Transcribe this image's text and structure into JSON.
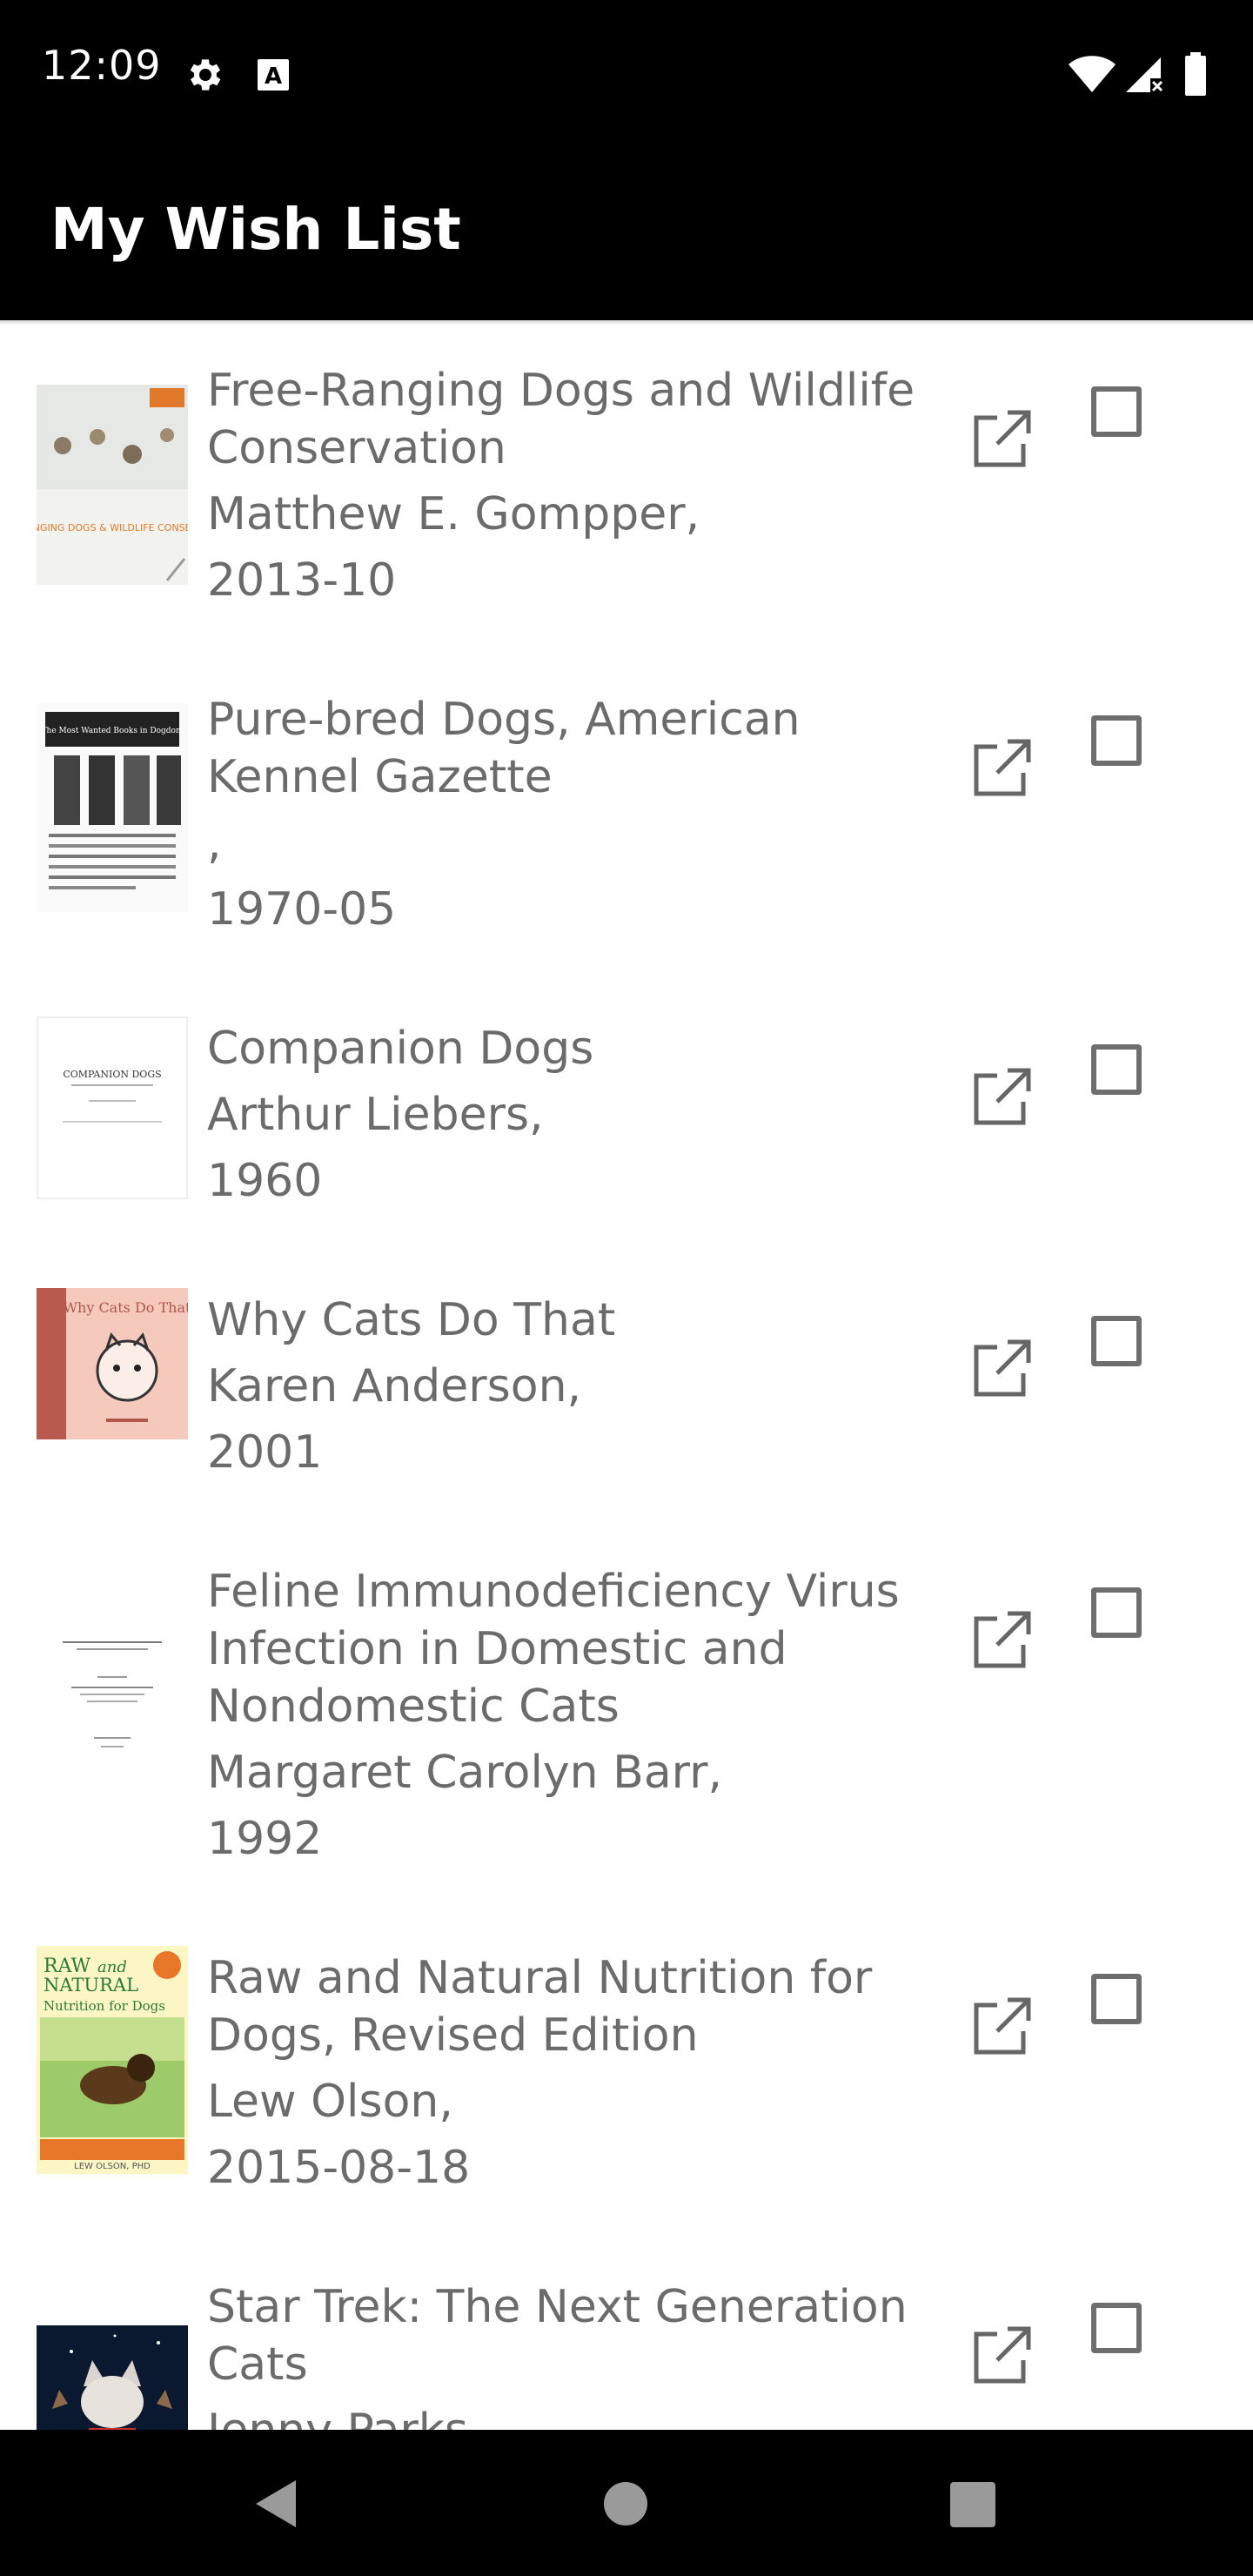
{
  "status_bar": {
    "time": "12:09",
    "icons": [
      "settings-icon",
      "keyboard-a-icon",
      "wifi-icon",
      "signal-icon",
      "battery-icon"
    ]
  },
  "app_bar": {
    "title": "My Wish List"
  },
  "books": [
    {
      "title_lines": [
        "Free-Ranging Dogs and Wildlife",
        "Conservation"
      ],
      "author": "Matthew E. Gompper,",
      "date": "2013-10",
      "cover_text": "FREE-RANGING DOGS & WILDLIFE CONSERVATION",
      "checked": false
    },
    {
      "title_lines": [
        "Pure-bred Dogs, American",
        "Kennel Gazette"
      ],
      "author": ",",
      "date": "1970-05",
      "cover_text": "The Most Wanted Books in Dogdom",
      "checked": false
    },
    {
      "title_lines": [
        "Companion Dogs"
      ],
      "author": "Arthur Liebers,",
      "date": "1960",
      "cover_text": "COMPANION DOGS",
      "checked": false
    },
    {
      "title_lines": [
        "Why Cats Do That"
      ],
      "author": "Karen Anderson,",
      "date": "2001",
      "cover_text": "Why Cats Do That",
      "checked": false
    },
    {
      "title_lines": [
        "Feline Immunodeficiency Virus",
        "Infection in Domestic and",
        "Nondomestic Cats"
      ],
      "author": "Margaret Carolyn Barr,",
      "date": "1992",
      "cover_text": "",
      "checked": false
    },
    {
      "title_lines": [
        "Raw and Natural Nutrition for",
        "Dogs, Revised Edition"
      ],
      "author": "Lew Olson,",
      "date": "2015-08-18",
      "cover_text": "RAW and NATURAL Nutrition for Dogs",
      "checked": false
    },
    {
      "title_lines": [
        "Star Trek: The Next Generation",
        "Cats"
      ],
      "author": "Jenny Parks,",
      "date": "",
      "cover_text": "",
      "checked": false
    }
  ],
  "nav_bar": {
    "buttons": [
      "back-icon",
      "home-icon",
      "recents-icon"
    ]
  }
}
